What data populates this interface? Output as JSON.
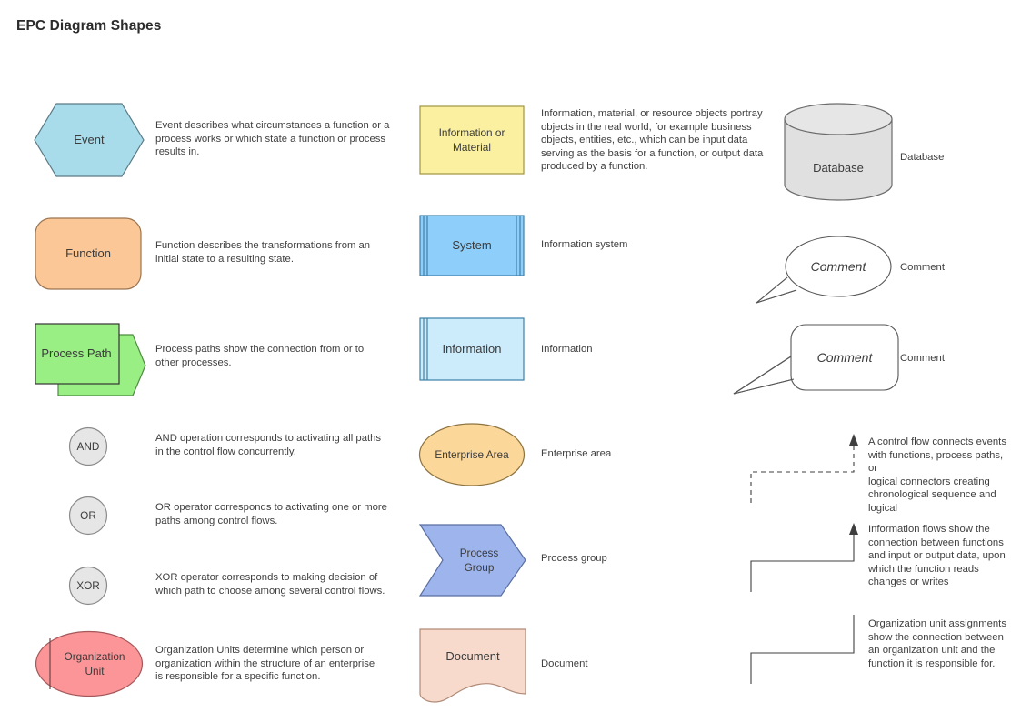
{
  "title": "EPC Diagram Shapes",
  "colors": {
    "event_fill": "#A8DCEA",
    "event_stroke": "#5A7A86",
    "function_fill": "#FCC797",
    "function_stroke": "#9A7450",
    "process_path_fill": "#99EE84",
    "process_path_stroke": "#4F8A42",
    "gateway_fill": "#E6E6E6",
    "gateway_stroke": "#8A8A8A",
    "org_unit_fill": "#FB9598",
    "org_unit_stroke": "#A5585A",
    "info_material_fill": "#FBF0A0",
    "info_material_stroke": "#A09440",
    "system_fill": "#8ECEFA",
    "system_stroke": "#3E7FA8",
    "information_fill": "#CCEBFB",
    "information_stroke": "#3E7FA8",
    "enterprise_fill": "#FBD79A",
    "enterprise_stroke": "#8C7340",
    "process_group_fill": "#9DB4EC",
    "process_group_stroke": "#5A6EA0",
    "document_fill": "#F7DACB",
    "document_stroke": "#B08A78",
    "database_fill": "#E0E0E0",
    "database_stroke": "#6B6B6B",
    "comment_stroke": "#565656",
    "connector_stroke": "#3F3F3F"
  },
  "shapes": {
    "event": {
      "label": "Event",
      "description": "Event describes what circumstances a function or a\nprocess works or which state a function or process\nresults in."
    },
    "function": {
      "label": "Function",
      "description": "Function describes the transformations from an\ninitial state to a resulting state."
    },
    "process_path": {
      "label": "Process Path",
      "description": "Process paths show the connection from or to\nother processes."
    },
    "and": {
      "label": "AND",
      "description": "AND operation corresponds to activating all paths\nin the control flow concurrently."
    },
    "or": {
      "label": "OR",
      "description": "OR operator corresponds to activating one or more\n paths among control flows."
    },
    "xor": {
      "label": "XOR",
      "description": "XOR operator corresponds to making decision of\nwhich path to choose among several control flows."
    },
    "organization_unit": {
      "label": "Organization\nUnit",
      "description": "Organization Units determine which person or\norganization within the structure of an enterprise\nis responsible for a specific function."
    },
    "information_or_material": {
      "label": "Information or\nMaterial",
      "description": "Information, material, or resource objects portray\nobjects in the real world, for example business\nobjects, entities, etc., which can be input data\nserving as the basis for a function, or output data\nproduced by a function."
    },
    "system": {
      "label": "System",
      "description": "Information system"
    },
    "information": {
      "label": "Information",
      "description": "Information"
    },
    "enterprise_area": {
      "label": "Enterprise Area",
      "description": "Enterprise area"
    },
    "process_group": {
      "label": "Process\nGroup",
      "description": "Process group"
    },
    "document": {
      "label": "Document",
      "description": "Document"
    },
    "database": {
      "label": "Database",
      "description": "Database"
    },
    "comment_oval": {
      "label": "Comment",
      "description": "Comment"
    },
    "comment_rounded": {
      "label": "Comment",
      "description": "Comment"
    }
  },
  "connectors": {
    "control_flow": {
      "description": "A control flow connects events\nwith functions, process paths, or\n logical connectors creating\nchronological sequence and\nlogical"
    },
    "information_flow": {
      "description": "Information flows show the\nconnection between functions\nand input or output data, upon\nwhich the function reads\nchanges or writes"
    },
    "organization_assignment": {
      "description": "Organization unit assignments\nshow the connection between\nan organization unit and the\nfunction it is responsible for."
    }
  }
}
